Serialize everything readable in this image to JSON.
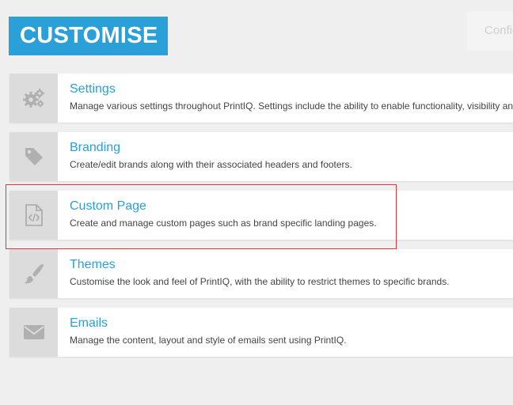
{
  "header": {
    "title": "CUSTOMISE",
    "config_label": "Config"
  },
  "items": [
    {
      "icon": "gears-icon",
      "title": "Settings",
      "description": "Manage various settings throughout PrintIQ. Settings include the ability to enable functionality, visibility and t"
    },
    {
      "icon": "tag-icon",
      "title": "Branding",
      "description": "Create/edit brands along with their associated headers and footers."
    },
    {
      "icon": "code-file-icon",
      "title": "Custom Page",
      "description": "Create and manage custom pages such as brand specific landing pages."
    },
    {
      "icon": "paintbrush-icon",
      "title": "Themes",
      "description": "Customise the look and feel of PrintIQ, with the ability to restrict themes to specific brands."
    },
    {
      "icon": "envelope-icon",
      "title": "Emails",
      "description": "Manage the content, layout and style of emails sent using PrintIQ."
    }
  ],
  "colors": {
    "accent": "#2a9fd8",
    "highlight": "#d9363e",
    "icon_bg": "#dcdcdc",
    "icon_fg": "#b0b0b0"
  }
}
